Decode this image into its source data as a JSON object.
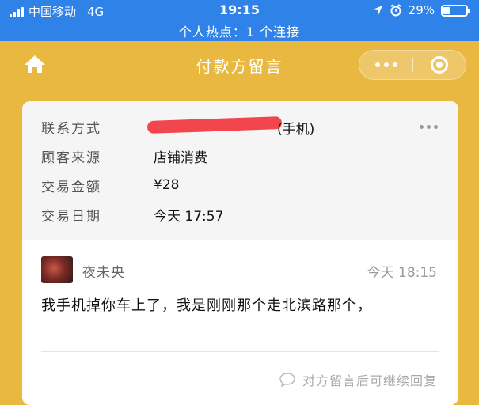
{
  "status_bar": {
    "carrier": "中国移动",
    "network": "4G",
    "time": "19:15",
    "battery": "29%",
    "battery_level": 0.29,
    "hotspot": "个人热点：1 个连接"
  },
  "nav": {
    "title": "付款方留言",
    "icons": {
      "home": "home-icon",
      "more": "more-dots-icon",
      "close": "close-target-icon"
    }
  },
  "info": {
    "rows": [
      {
        "label": "联系方式",
        "value": "(手机)"
      },
      {
        "label": "顾客来源",
        "value": "店铺消费"
      },
      {
        "label": "交易金额",
        "value": "¥28"
      },
      {
        "label": "交易日期",
        "value": "今天 17:57"
      }
    ]
  },
  "message": {
    "sender": "夜未央",
    "time": "今天 18:15",
    "text": "我手机掉你车上了，我是刚刚那个走北滨路那个，",
    "reply_hint": "对方留言后可继续回复"
  },
  "colors": {
    "status_bar": "#2F82E8",
    "nav": "#E9B840",
    "redaction": "#F2464F"
  }
}
